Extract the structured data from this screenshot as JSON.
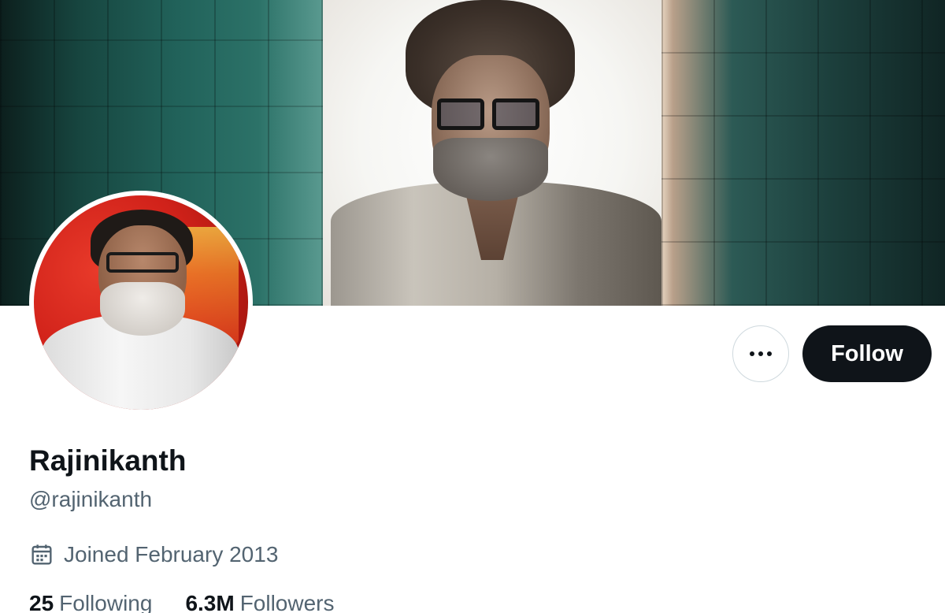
{
  "header": {
    "banner_image": "profile-banner"
  },
  "profile": {
    "display_name": "Rajinikanth",
    "handle": "@rajinikanth",
    "joined": "Joined February 2013",
    "avatar": "profile-avatar"
  },
  "actions": {
    "more_icon": "more-horizontal-icon",
    "follow_label": "Follow"
  },
  "stats": {
    "following_count": "25",
    "following_label": "Following",
    "followers_count": "6.3M",
    "followers_label": "Followers"
  },
  "colors": {
    "text_primary": "#0f1419",
    "text_secondary": "#536471",
    "follow_bg": "#0f1419",
    "border": "#cfd9de"
  }
}
